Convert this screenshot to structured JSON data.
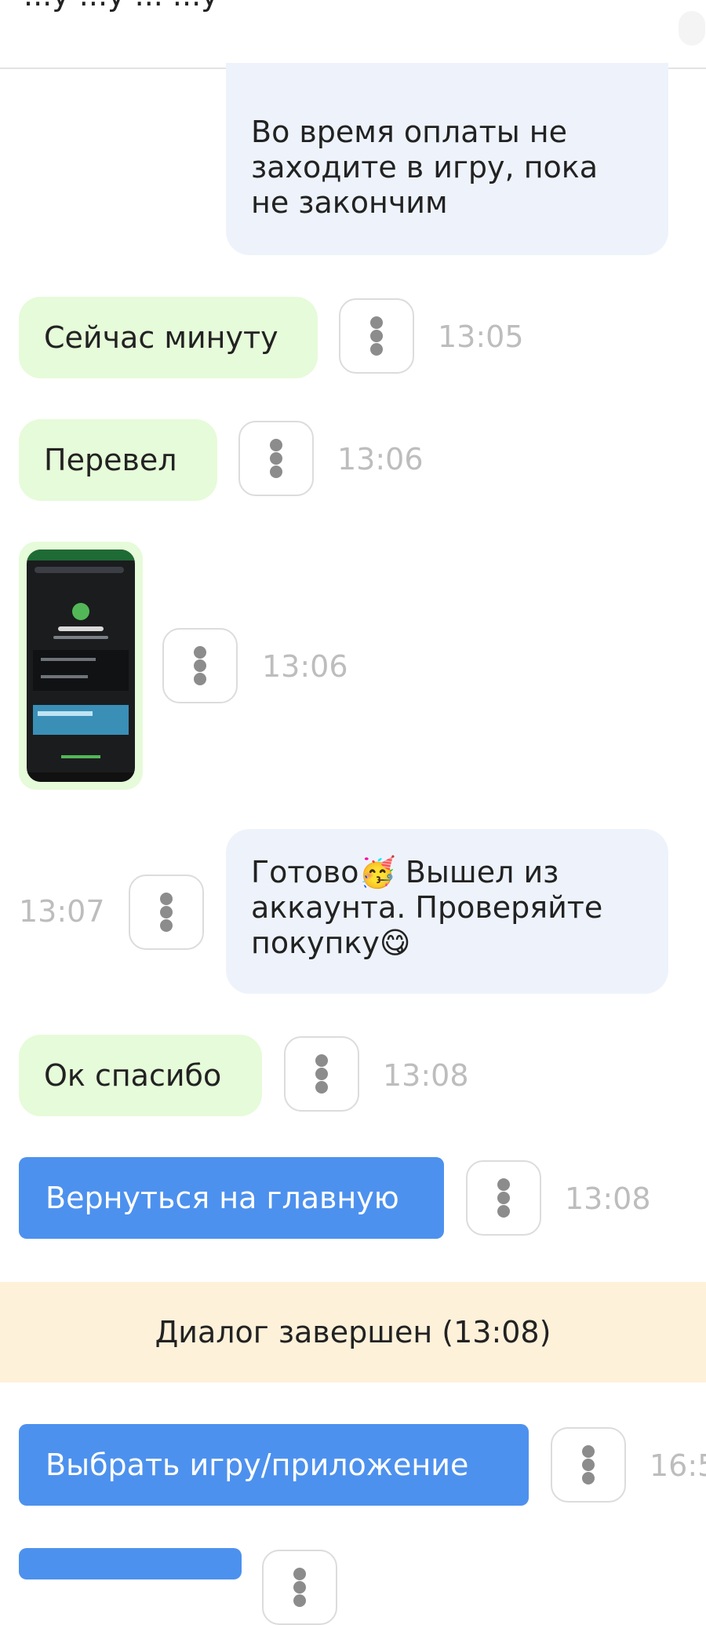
{
  "header": {
    "title_partial": "...y ...y ... ...y"
  },
  "messages": [
    {
      "id": "m0",
      "text": "Во время оплаты не заходите в игру, пока не закончим",
      "line1": "Во время оплаты не",
      "line2": "заходите в игру, пока",
      "line3": "не закончим"
    },
    {
      "id": "m1",
      "text": "Сейчас минуту",
      "time": "13:05"
    },
    {
      "id": "m2",
      "text": "Перевел",
      "time": "13:06"
    },
    {
      "id": "m3",
      "type": "image",
      "time": "13:06"
    },
    {
      "id": "m4",
      "line1_a": "Готово",
      "emoji1": "🥳",
      "line1_b": " Вышел из",
      "line2": "аккаунта. Проверяйте",
      "line3_a": "покупку",
      "emoji2": "😋",
      "time": "13:07"
    },
    {
      "id": "m5",
      "text": "Ок спасибо",
      "time": "13:08"
    },
    {
      "id": "m6",
      "button": "Вернуться на главную",
      "time": "13:08"
    },
    {
      "id": "m7",
      "button": "Выбрать игру/приложение",
      "time": "16:5"
    }
  ],
  "system_notice": "Диалог завершен (13:08)",
  "icons": {
    "more": "more-vertical-icon"
  },
  "colors": {
    "incoming_bubble": "#e6fbd9",
    "outgoing_bubble": "#eef3fb",
    "action_button": "#4d91ee",
    "system_notice": "#fdf1da",
    "timestamp": "#bdbdbd"
  }
}
